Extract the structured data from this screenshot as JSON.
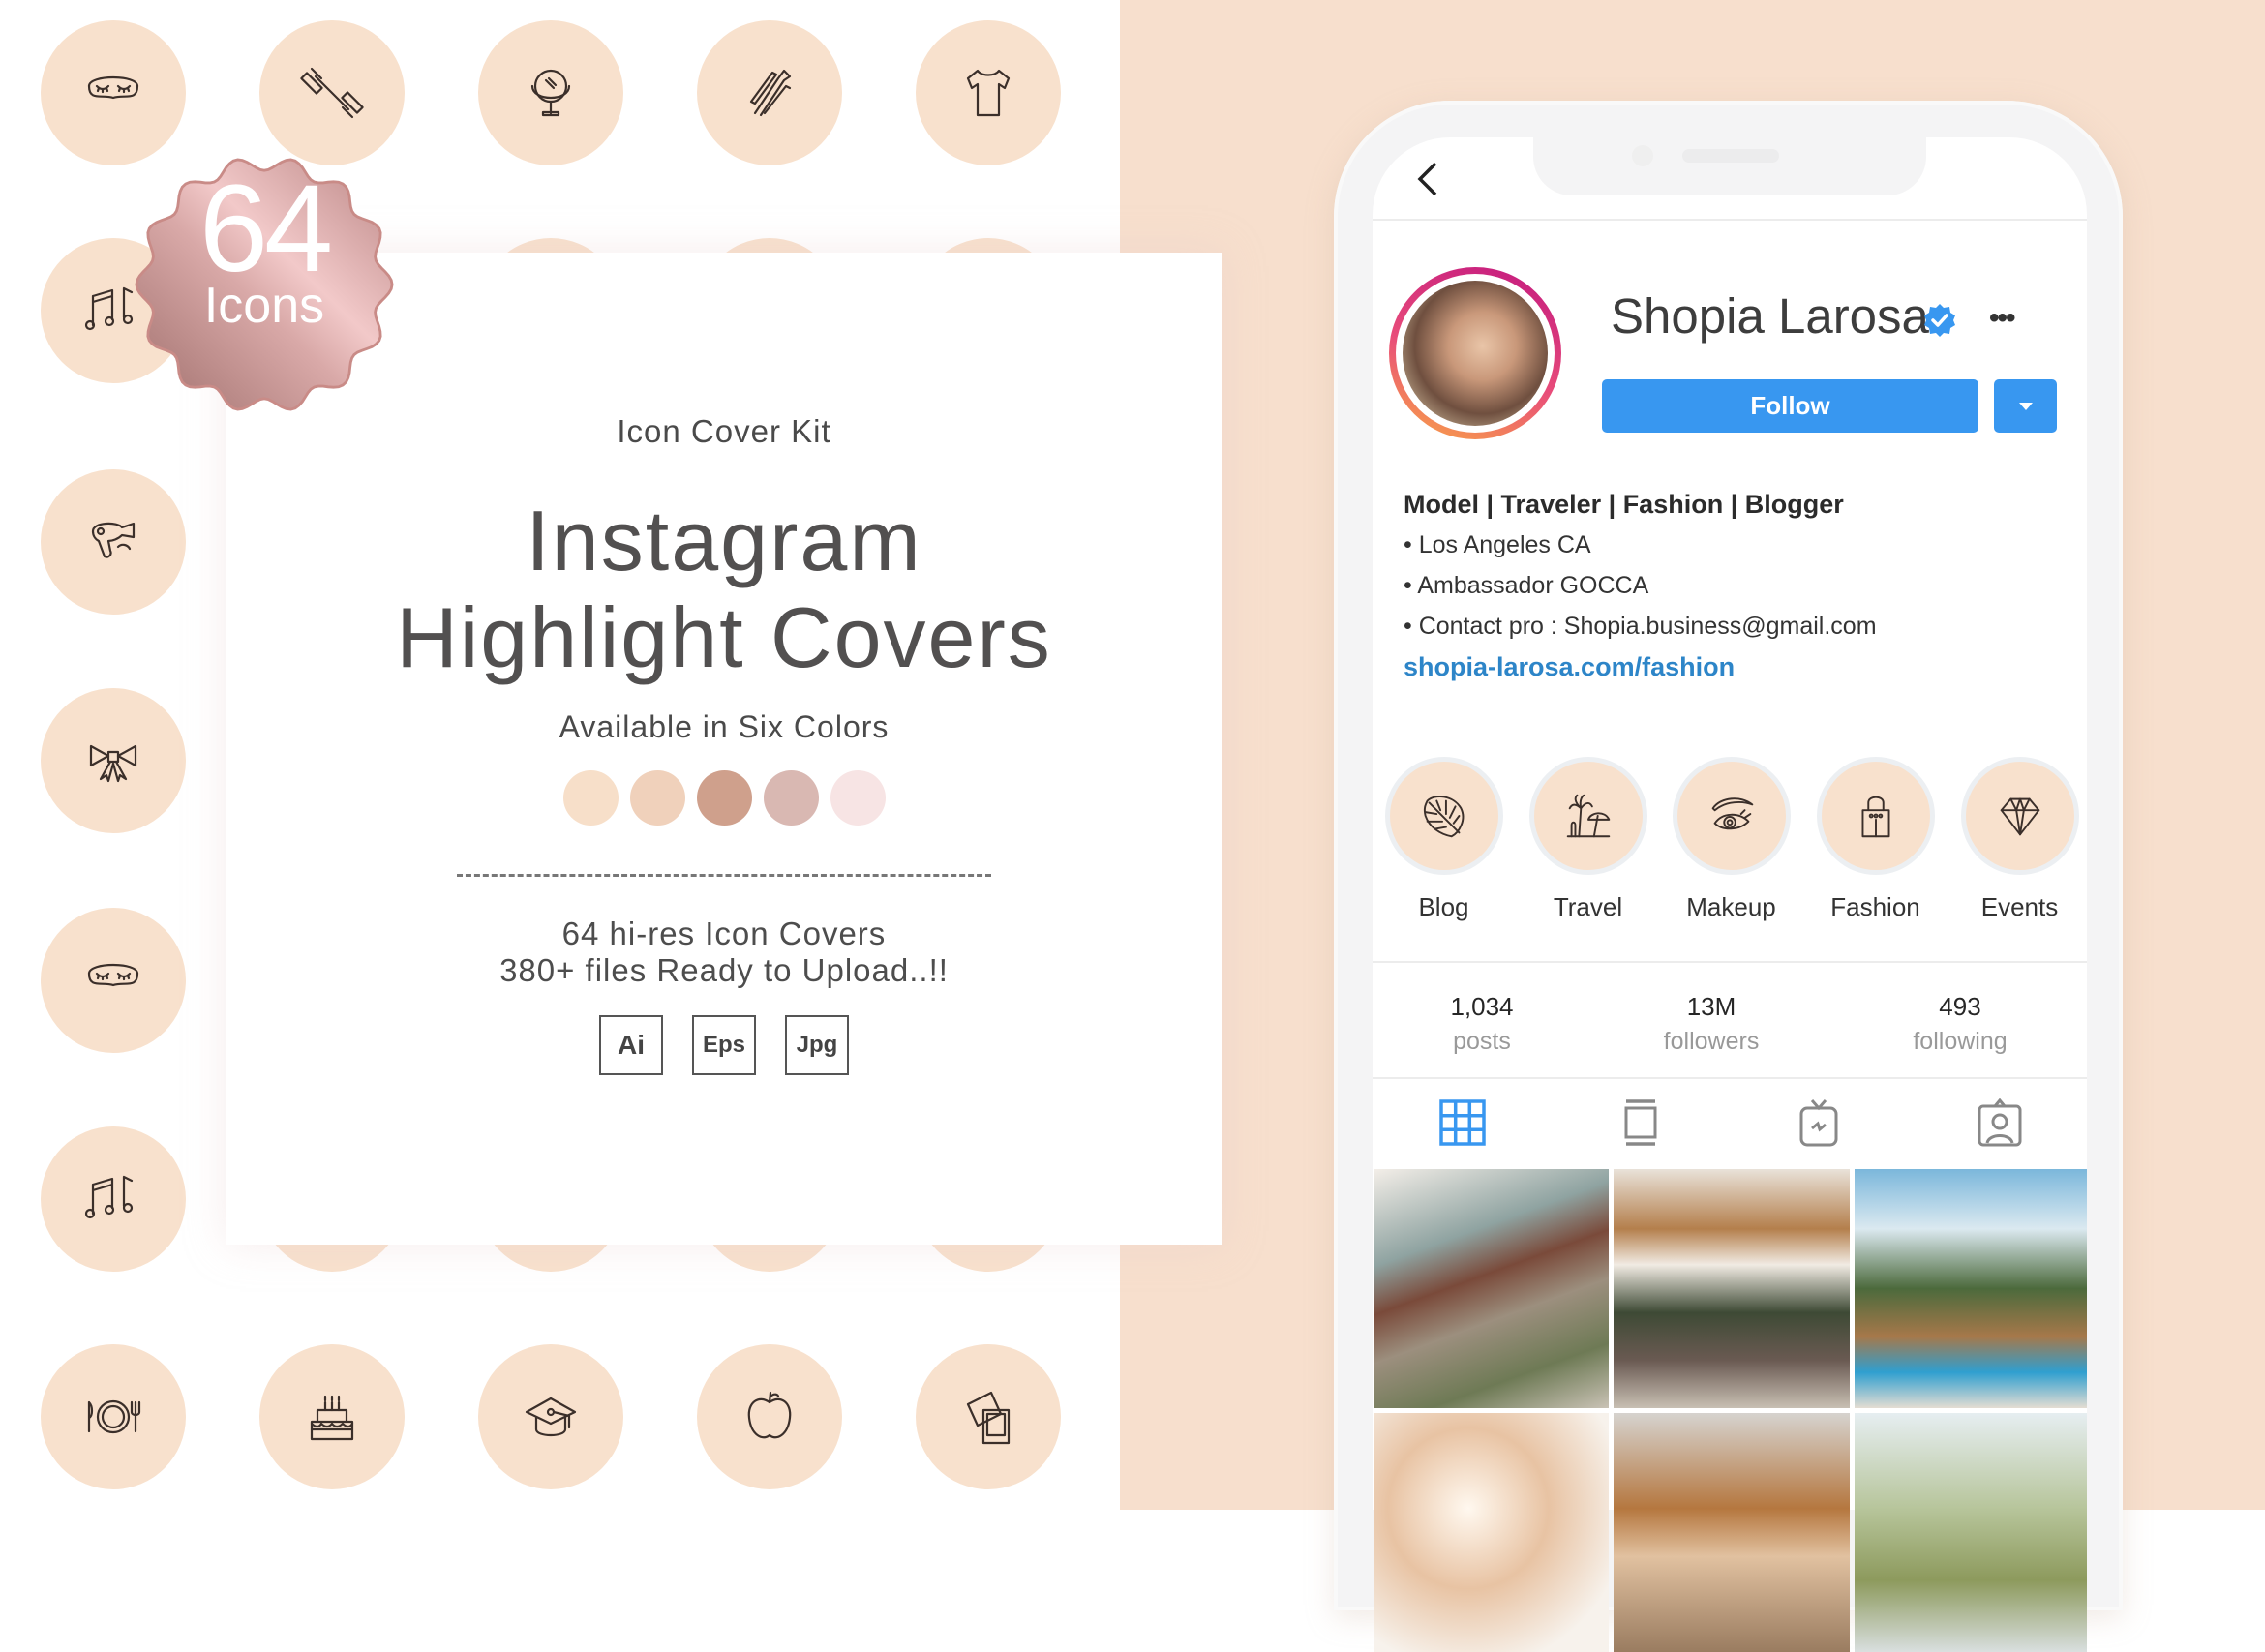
{
  "colors": {
    "page_left": "#ffffff",
    "page_right": "#f7dfcd",
    "icon_circle": "#f8e1cd",
    "accent_blue": "#3897f0",
    "link_blue": "#2d85c8",
    "badge_rose": "#c98f90"
  },
  "icon_grid": {
    "icons": [
      "sleep-mask-icon",
      "dumbbell-icon",
      "mirror-icon",
      "makeup-brushes-icon",
      "tshirt-icon",
      "music-notes-icon",
      "hair-dryer-icon",
      "bow-icon",
      "sleep-mask-icon",
      "music-notes-icon",
      "plate-cutlery-icon",
      "cake-icon",
      "graduation-cap-icon",
      "apple-icon",
      "photos-icon"
    ]
  },
  "badge": {
    "number": "64",
    "label": "Icons"
  },
  "card": {
    "kicker": "Icon Cover Kit",
    "title_line1": "Instagram",
    "title_line2": "Highlight Covers",
    "available": "Available in Six Colors",
    "swatches": [
      "#f7dfc9",
      "#f0d1bb",
      "#cfa08c",
      "#d9b8b2",
      "#f7e4e4"
    ],
    "features_line1": "64 hi-res Icon Covers",
    "features_line2": "380+ files Ready to Upload..!!",
    "formats": [
      "Ai",
      "Eps",
      "Jpg"
    ]
  },
  "profile": {
    "name": "Shopia Larosa",
    "verified": true,
    "follow_label": "Follow",
    "more_label": "•••",
    "bio_headline": "Model | Traveler | Fashion | Blogger",
    "bio_lines": [
      "• Los Angeles CA",
      "• Ambassador GOCCA",
      "• Contact pro : Shopia.business@gmail.com"
    ],
    "website": "shopia-larosa.com/fashion",
    "highlights": [
      {
        "label": "Blog",
        "icon": "monstera-leaf-icon"
      },
      {
        "label": "Travel",
        "icon": "palm-umbrella-icon"
      },
      {
        "label": "Makeup",
        "icon": "eye-brow-icon"
      },
      {
        "label": "Fashion",
        "icon": "shopping-bag-icon"
      },
      {
        "label": "Events",
        "icon": "diamond-icon"
      }
    ],
    "stats": [
      {
        "value": "1,034",
        "label": "posts"
      },
      {
        "value": "13M",
        "label": "followers"
      },
      {
        "value": "493",
        "label": "following"
      }
    ],
    "tabs": [
      "grid-icon",
      "feed-icon",
      "igtv-icon",
      "tagged-icon"
    ],
    "active_tab": "grid-icon",
    "photos": [
      "tiled-doorway",
      "woman-hat-bicycles",
      "palm-pool-resort",
      "woman-sunlight",
      "woman-brown-hat",
      "palm-tree-sky"
    ]
  }
}
